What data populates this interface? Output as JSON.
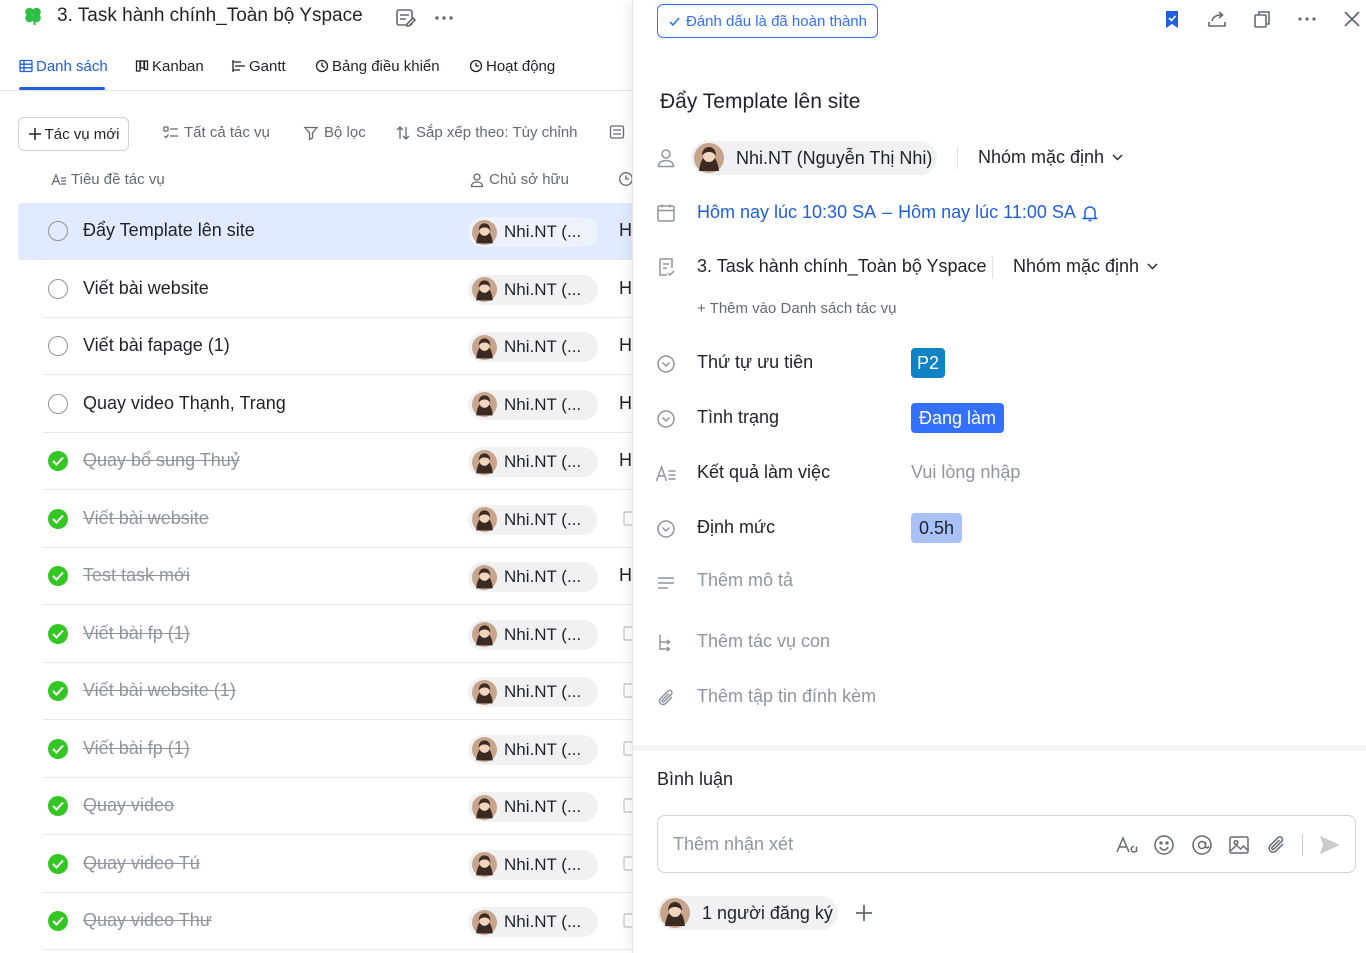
{
  "project": {
    "title": "3. Task hành chính_Toàn bộ Yspace"
  },
  "view_tabs": [
    {
      "label": "Danh sách",
      "icon": "table-icon",
      "active": true
    },
    {
      "label": "Kanban",
      "icon": "kanban-icon",
      "active": false
    },
    {
      "label": "Gantt",
      "icon": "gantt-icon",
      "active": false
    },
    {
      "label": "Bảng điều khiển",
      "icon": "dashboard-icon",
      "active": false
    },
    {
      "label": "Hoạt động",
      "icon": "activity-icon",
      "active": false
    }
  ],
  "toolbar": {
    "new_task": "Tác vụ mới",
    "all_tasks": "Tất cả tác vụ",
    "filter": "Bộ lọc",
    "sort": "Sắp xếp theo: Tùy chỉnh"
  },
  "columns": {
    "title": "Tiêu đề tác vụ",
    "owner": "Chủ sở hữu"
  },
  "tasks": [
    {
      "name": "Đẩy Template lên site",
      "owner": "Nhi.NT (...",
      "done": false,
      "selected": true,
      "tail": "H"
    },
    {
      "name": "Viết bài website",
      "owner": "Nhi.NT (...",
      "done": false,
      "selected": false,
      "tail": "H"
    },
    {
      "name": "Viết bài fapage (1)",
      "owner": "Nhi.NT (...",
      "done": false,
      "selected": false,
      "tail": "H"
    },
    {
      "name": "Quay video Thạnh, Trang",
      "owner": "Nhi.NT (...",
      "done": false,
      "selected": false,
      "tail": "H"
    },
    {
      "name": "Quay bổ sung Thuỷ",
      "owner": "Nhi.NT (...",
      "done": true,
      "selected": false,
      "tail": "H"
    },
    {
      "name": "Viết bài website",
      "owner": "Nhi.NT (...",
      "done": true,
      "selected": false,
      "tail": ""
    },
    {
      "name": "Test task mới",
      "owner": "Nhi.NT (...",
      "done": true,
      "selected": false,
      "tail": "H"
    },
    {
      "name": "Viết bài fp (1)",
      "owner": "Nhi.NT (...",
      "done": true,
      "selected": false,
      "tail": ""
    },
    {
      "name": "Viết bài website (1)",
      "owner": "Nhi.NT (...",
      "done": true,
      "selected": false,
      "tail": ""
    },
    {
      "name": "Viết bài fp (1)",
      "owner": "Nhi.NT (...",
      "done": true,
      "selected": false,
      "tail": ""
    },
    {
      "name": "Quay video",
      "owner": "Nhi.NT (...",
      "done": true,
      "selected": false,
      "tail": ""
    },
    {
      "name": "Quay video Tú",
      "owner": "Nhi.NT (...",
      "done": true,
      "selected": false,
      "tail": ""
    },
    {
      "name": "Quay video Thư",
      "owner": "Nhi.NT (...",
      "done": true,
      "selected": false,
      "tail": ""
    }
  ],
  "detail": {
    "complete_button": "Đánh dấu là đã hoàn thành",
    "title": "Đẩy Template lên site",
    "assignee": "Nhi.NT (Nguyễn Thị Nhi)",
    "assignee_group": "Nhóm mặc định",
    "time_start": "Hôm nay lúc 10:30 SA",
    "time_dash": "–",
    "time_end": "Hôm nay lúc 11:00 SA",
    "list_name": "3. Task hành chính_Toàn bộ Yspace",
    "list_group": "Nhóm mặc định",
    "add_to_list": "Thêm vào Danh sách tác vụ",
    "priority_label": "Thứ tự ưu tiên",
    "priority_value": "P2",
    "status_label": "Tình trạng",
    "status_value": "Đang làm",
    "result_label": "Kết quả làm việc",
    "result_placeholder": "Vui lòng nhập",
    "quota_label": "Định mức",
    "quota_value": "0.5h",
    "add_description": "Thêm mô tả",
    "add_subtask": "Thêm tác vụ con",
    "add_attachment": "Thêm tập tin đính kèm"
  },
  "comments": {
    "title": "Bình luận",
    "placeholder": "Thêm nhận xét",
    "subscribers": "1 người đăng ký"
  },
  "colors": {
    "accent": "#3370ff",
    "link": "#1f5fe0",
    "done_green": "#34c724",
    "priority_p2": "#0e84c6",
    "status_doing": "#3370ff",
    "quota_bg": "#a9c1f9",
    "selected_row": "#e1eaff"
  }
}
